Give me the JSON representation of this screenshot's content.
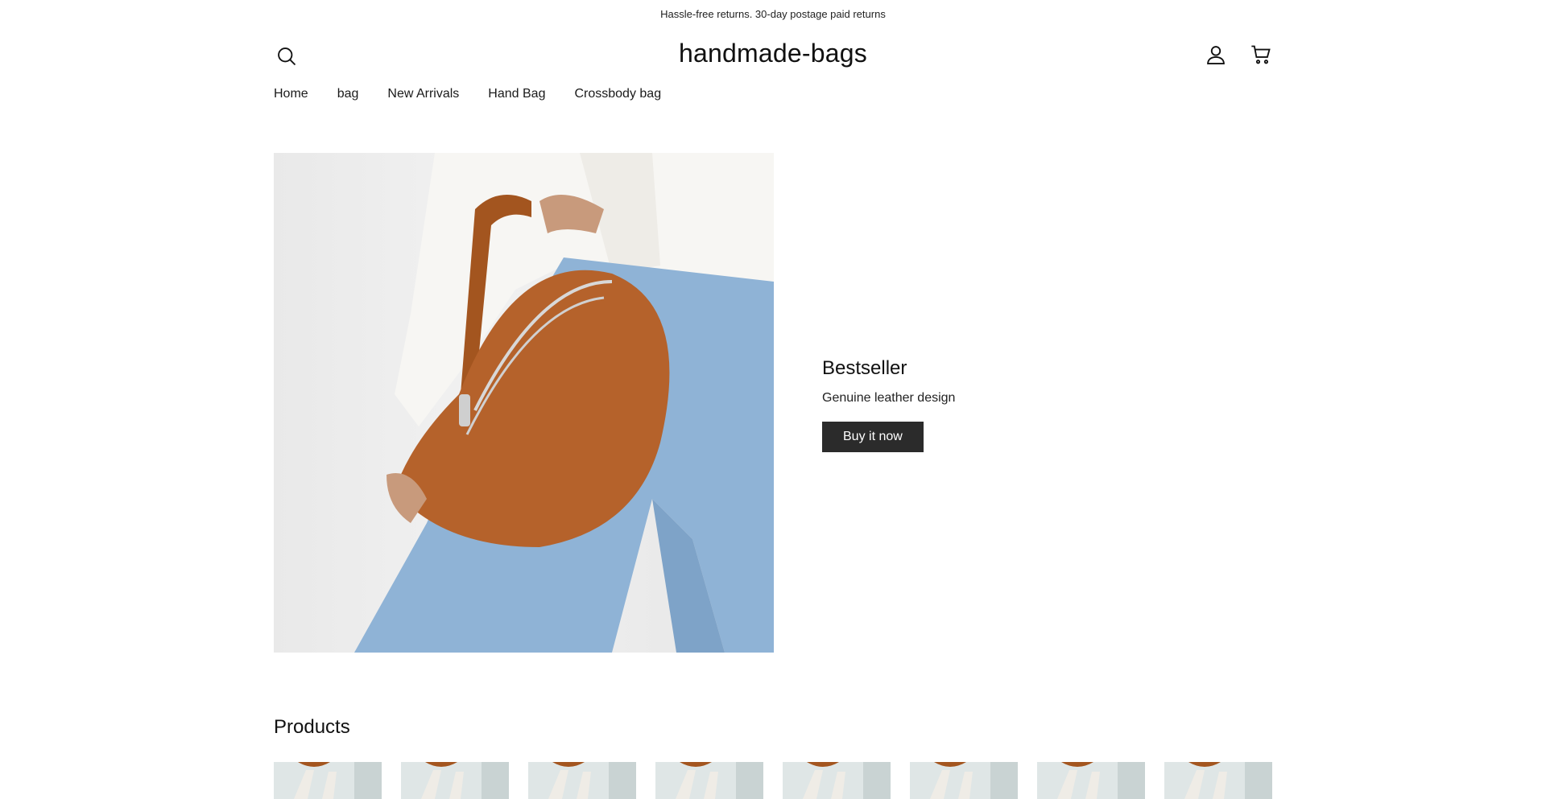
{
  "announcement": "Hassle-free returns. 30-day postage paid returns",
  "header": {
    "logo": "handmade-bags",
    "icons": {
      "search": "search-icon",
      "account": "account-icon",
      "cart": "cart-icon"
    }
  },
  "nav": {
    "items": [
      {
        "label": "Home"
      },
      {
        "label": "bag"
      },
      {
        "label": "New Arrivals"
      },
      {
        "label": "Hand Bag"
      },
      {
        "label": "Crossbody bag"
      }
    ]
  },
  "hero": {
    "title": "Bestseller",
    "subtitle": "Genuine leather design",
    "cta": "Buy it now"
  },
  "products": {
    "title": "Products",
    "count_visible": 8
  },
  "colors": {
    "cta_bg": "#2b2b2b",
    "bag_leather": "#b5622b",
    "denim": "#8fb3d6"
  }
}
